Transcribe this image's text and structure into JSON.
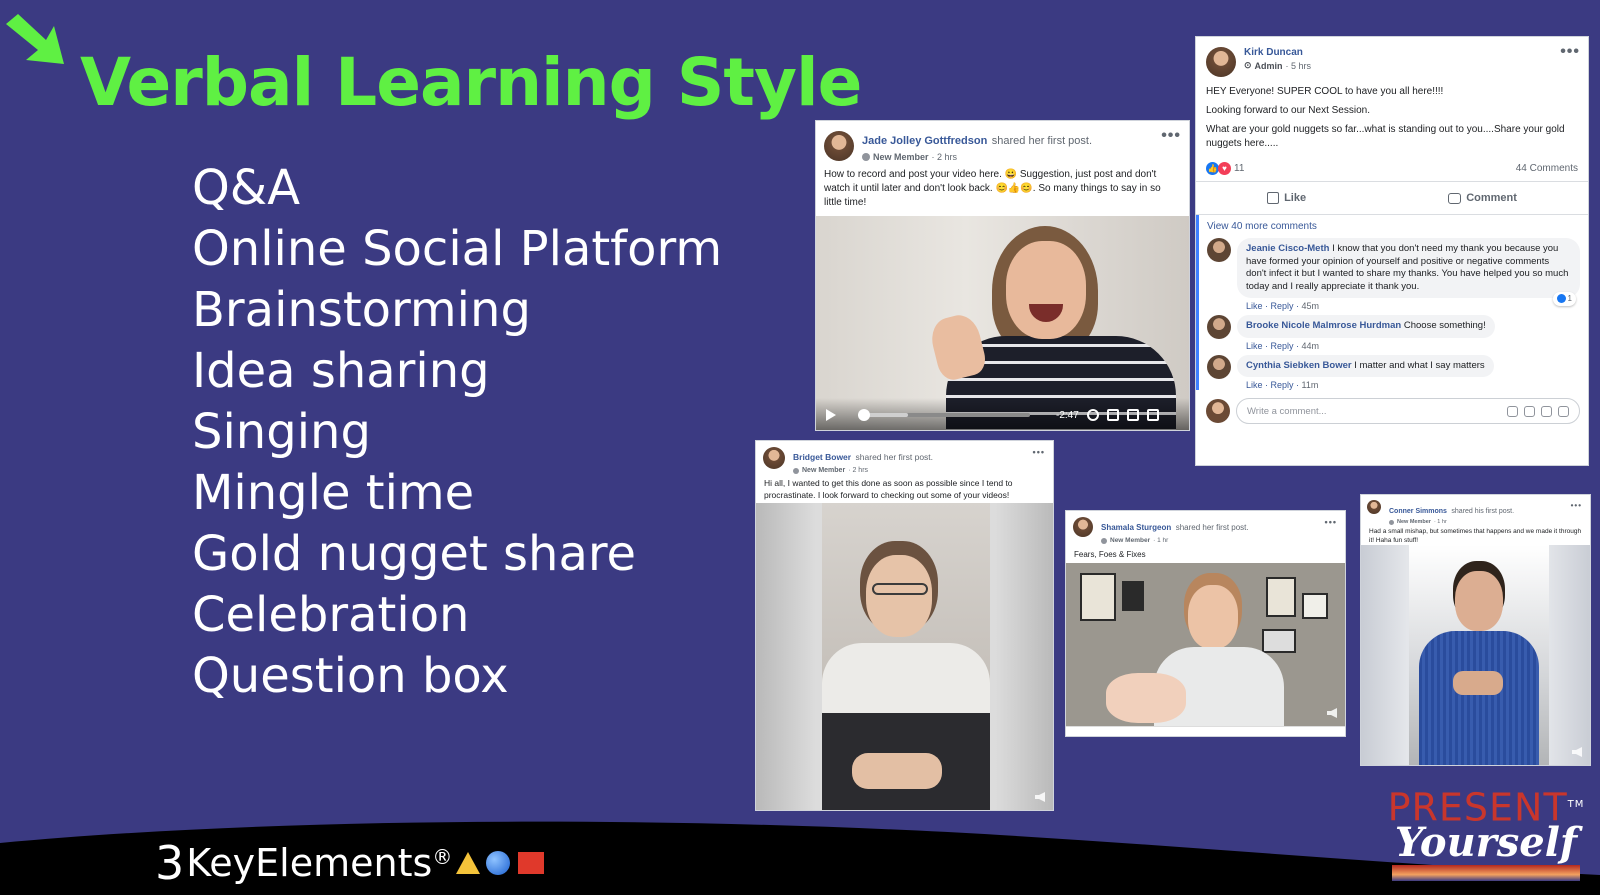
{
  "slide": {
    "title": "Verbal Learning Style",
    "bullets": [
      "Q&A",
      "Online Social Platform",
      "Brainstorming",
      "Idea sharing",
      "Singing",
      "Mingle time",
      "Gold nugget share",
      "Celebration",
      "Question box"
    ]
  },
  "brand": {
    "number": "3",
    "text": "KeyElements",
    "registered": "®"
  },
  "logo": {
    "present": "PRESENT",
    "tm": "TM",
    "yourself": "Yourself"
  },
  "posts": {
    "jade": {
      "name": "Jade Jolley Gottfredson",
      "action": "shared her first post.",
      "role": "New Member",
      "time": "· 2 hrs",
      "text": "How to record and post your video here. 😀 Suggestion, just post and don't watch it until later and don't look back. 😊👍😊. So many things to say in so little time!",
      "video_time": "-2:47",
      "progress": 0.0
    },
    "kirk": {
      "name": "Kirk Duncan",
      "role": "Admin",
      "time": "· 5 hrs",
      "line1": "HEY Everyone! SUPER COOL to have you all here!!!!",
      "line2": "Looking forward to our Next Session.",
      "line3": "What are your gold nuggets so far...what is standing out to you....Share your gold nuggets here.....",
      "reactions_count": "11",
      "comments_count": "44 Comments",
      "like_label": "Like",
      "comment_label": "Comment",
      "view_more": "View 40 more comments",
      "comments": [
        {
          "name": "Jeanie Cisco-Meth",
          "text": "I know that you don't need my thank you because you have formed your opinion of yourself and positive or negative comments don't infect it but I wanted to share my thanks. You have helped you so much today and I really appreciate it thank you.",
          "meta": "Like · Reply ·",
          "time": "45m",
          "likes": "1"
        },
        {
          "name": "Brooke Nicole Malmrose Hurdman",
          "text": "Choose something!",
          "meta": "Like · Reply ·",
          "time": "44m"
        },
        {
          "name": "Cynthia Siebken Bower",
          "text": "I matter and what I say matters",
          "meta": "Like · Reply ·",
          "time": "11m"
        }
      ],
      "write_placeholder": "Write a comment..."
    },
    "bridget": {
      "name": "Bridget Bower",
      "action": "shared her first post.",
      "role": "New Member",
      "time": "· 2 hrs",
      "text": "Hi all, I wanted to get this done as soon as possible since I tend to procrastinate. I look forward to checking out some of your videos!"
    },
    "shamala": {
      "name": "Shamala Sturgeon",
      "action": "shared her first post.",
      "role": "New Member",
      "time": "· 1 hr",
      "text": "Fears, Foes & Fixes"
    },
    "conner": {
      "name": "Conner Simmons",
      "action": "shared his first post.",
      "role": "New Member",
      "time": "· 1 hr",
      "text": "Had a small mishap, but sometimes that happens and we made it through it! Haha fun stuff!"
    }
  },
  "colors": {
    "background": "#3b3a82",
    "title": "#5ff043",
    "fb_link": "#385898"
  }
}
